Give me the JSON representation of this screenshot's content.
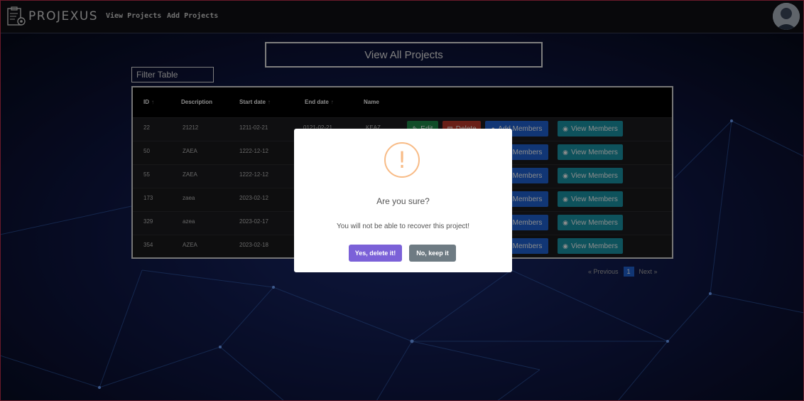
{
  "nav": {
    "brand": "PROJEXUS",
    "links": [
      "View Projects",
      "Add Projects"
    ]
  },
  "page": {
    "title": "View All Projects",
    "filter_placeholder": "Filter Table"
  },
  "table": {
    "headers": [
      "ID",
      "Description",
      "Start date",
      "End date",
      "Name"
    ],
    "rows": [
      {
        "id": "22",
        "description": "21212",
        "start": "1211-02-21",
        "end": "0121-02-21",
        "name": "KEAZ"
      },
      {
        "id": "50",
        "description": "ZAEA",
        "start": "1222-12-12",
        "end": "",
        "name": ""
      },
      {
        "id": "55",
        "description": "ZAEA",
        "start": "1222-12-12",
        "end": "",
        "name": ""
      },
      {
        "id": "173",
        "description": "zaea",
        "start": "2023-02-12",
        "end": "",
        "name": ""
      },
      {
        "id": "329",
        "description": "azea",
        "start": "2023-02-17",
        "end": "",
        "name": ""
      },
      {
        "id": "354",
        "description": "AZEA",
        "start": "2023-02-18",
        "end": "",
        "name": ""
      }
    ],
    "actions": {
      "edit": "Edit",
      "delete": "Delete",
      "add_members": "Add Members",
      "view_members": "View Members"
    }
  },
  "pagination": {
    "previous": "« Previous",
    "current": "1",
    "next": "Next »"
  },
  "modal": {
    "icon": "!",
    "title": "Are you sure?",
    "text": "You will not be able to recover this project!",
    "confirm": "Yes, delete it!",
    "cancel": "No, keep it"
  },
  "colors": {
    "edit": "#1e8a4a",
    "delete": "#c0392b",
    "add_members": "#1f63d6",
    "view_members": "#1b96a8",
    "confirm": "#7b61d8",
    "cancel": "#6e7b83",
    "warning": "#f8bb86"
  }
}
